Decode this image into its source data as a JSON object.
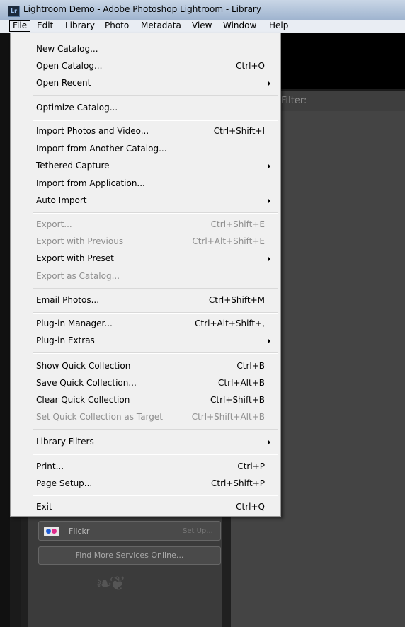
{
  "window": {
    "title": "Lightroom Demo - Adobe Photoshop Lightroom - Library",
    "logo": "Lr"
  },
  "menubar": {
    "items": [
      "File",
      "Edit",
      "Library",
      "Photo",
      "Metadata",
      "View",
      "Window",
      "Help"
    ],
    "active": "File"
  },
  "filter_label": "Filter:",
  "file_menu": {
    "new_catalog": {
      "label": "New Catalog..."
    },
    "open_catalog": {
      "label": "Open Catalog...",
      "shortcut": "Ctrl+O"
    },
    "open_recent": {
      "label": "Open Recent"
    },
    "optimize_catalog": {
      "label": "Optimize Catalog..."
    },
    "import_photos": {
      "label": "Import Photos and Video...",
      "shortcut": "Ctrl+Shift+I"
    },
    "import_catalog": {
      "label": "Import from Another Catalog..."
    },
    "tethered_capture": {
      "label": "Tethered Capture"
    },
    "import_application": {
      "label": "Import from Application..."
    },
    "auto_import": {
      "label": "Auto Import"
    },
    "export": {
      "label": "Export...",
      "shortcut": "Ctrl+Shift+E"
    },
    "export_previous": {
      "label": "Export with Previous",
      "shortcut": "Ctrl+Alt+Shift+E"
    },
    "export_preset": {
      "label": "Export with Preset"
    },
    "export_catalog": {
      "label": "Export as Catalog..."
    },
    "email_photos": {
      "label": "Email Photos...",
      "shortcut": "Ctrl+Shift+M"
    },
    "plugin_manager": {
      "label": "Plug-in Manager...",
      "shortcut": "Ctrl+Alt+Shift+,"
    },
    "plugin_extras": {
      "label": "Plug-in Extras"
    },
    "show_quick": {
      "label": "Show Quick Collection",
      "shortcut": "Ctrl+B"
    },
    "save_quick": {
      "label": "Save Quick Collection...",
      "shortcut": "Ctrl+Alt+B"
    },
    "clear_quick": {
      "label": "Clear Quick Collection",
      "shortcut": "Ctrl+Shift+B"
    },
    "set_quick_target": {
      "label": "Set Quick Collection as Target",
      "shortcut": "Ctrl+Shift+Alt+B"
    },
    "library_filters": {
      "label": "Library Filters"
    },
    "print": {
      "label": "Print...",
      "shortcut": "Ctrl+P"
    },
    "page_setup": {
      "label": "Page Setup...",
      "shortcut": "Ctrl+Shift+P"
    },
    "exit": {
      "label": "Exit",
      "shortcut": "Ctrl+Q"
    }
  },
  "publish_services": {
    "flickr": {
      "name": "Flickr",
      "action": "Set Up..."
    },
    "find_more": "Find More Services Online..."
  },
  "icons": {
    "app": "lightroom-logo-icon",
    "submenu": "submenu-arrow-icon",
    "flickr": "flickr-logo-icon",
    "ornament": "panel-end-ornament-icon"
  }
}
